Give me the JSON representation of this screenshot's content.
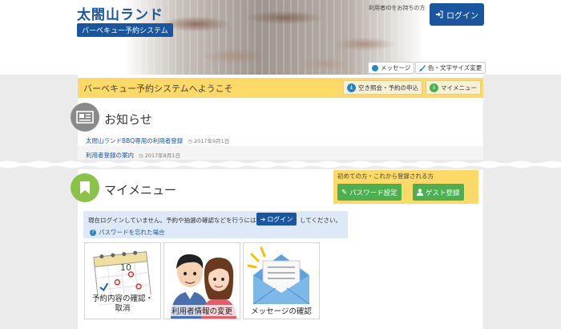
{
  "header": {
    "site_title": "太閤山ランド",
    "system_subtitle": "バーベキュー予約システム",
    "user_note": "利用者IDをお持ちの方",
    "login_label": "ログイン",
    "message_label": "メッセージ",
    "font_size_label": "色・文字サイズ変更"
  },
  "welcome": {
    "text": "バーベキュー予約システムへようこそ",
    "vacancy_button": "空き照会・予約の申込",
    "mymenu_button": "マイメニュー"
  },
  "news": {
    "title": "お知らせ",
    "items": [
      {
        "text": "太閤山ランドBBQ専用の利用者登録",
        "date": "2017年9月1日"
      },
      {
        "text": "利用者登録の案内",
        "date": "2017年8月1日"
      }
    ]
  },
  "mymenu": {
    "title": "マイメニュー",
    "first_time_text": "初めての方・これから登録される方",
    "password_button": "パスワード設定",
    "guest_button": "ゲスト登録",
    "notice_pre": "現在ログインしていません。予約や抽選の確認などを行うには",
    "notice_login_button": "ログイン",
    "notice_post": "してください。",
    "forgot_link": "パスワードを忘れた場合",
    "tiles": [
      {
        "label_line1": "予約内容の確認・",
        "label_line2": "取消",
        "icon": "calendar-icon"
      },
      {
        "label_line1": "利用者情報の変更",
        "label_line2": "",
        "icon": "users-icon"
      },
      {
        "label_line1": "メッセージの確認",
        "label_line2": "",
        "icon": "mail-icon"
      }
    ],
    "calendar_number": "10"
  },
  "colors": {
    "brand_blue": "#1a56a0",
    "accent_yellow": "#fdd968",
    "green": "#4caf50"
  }
}
